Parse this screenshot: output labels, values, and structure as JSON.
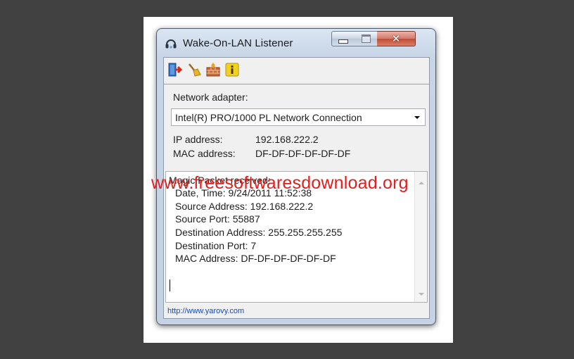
{
  "window": {
    "title": "Wake-On-LAN Listener",
    "title_icon": "headset-icon",
    "controls": {
      "minimize": "minimize-icon",
      "maximize": "maximize-icon",
      "close_glyph": "✕"
    }
  },
  "toolbar": {
    "items": [
      {
        "name": "exit-icon",
        "tooltip": "Exit"
      },
      {
        "name": "broom-icon",
        "tooltip": "Clear"
      },
      {
        "name": "firewall-icon",
        "tooltip": "Firewall"
      },
      {
        "name": "info-icon",
        "tooltip": "About"
      }
    ]
  },
  "adapter": {
    "label": "Network adapter:",
    "selected": "Intel(R) PRO/1000 PL Network Connection",
    "ip_label": "IP address:",
    "ip_value": "192.168.222.2",
    "mac_label": "MAC address:",
    "mac_value": "DF-DF-DF-DF-DF-DF"
  },
  "log": {
    "header": "Magic Packet received:",
    "lines": [
      "Date, Time: 9/24/2011 11:52:38",
      "Source Address: 192.168.222.2",
      "Source Port: 55887",
      "Destination Address: 255.255.255.255",
      "Destination Port: 7",
      "MAC Address: DF-DF-DF-DF-DF-DF"
    ]
  },
  "status": {
    "link": "http://www.yarovy.com"
  },
  "watermark": "www.freesoftwaresdownload.org",
  "colors": {
    "watermark": "#e02020",
    "link": "#1a4aa8",
    "backdrop": "#414141"
  }
}
